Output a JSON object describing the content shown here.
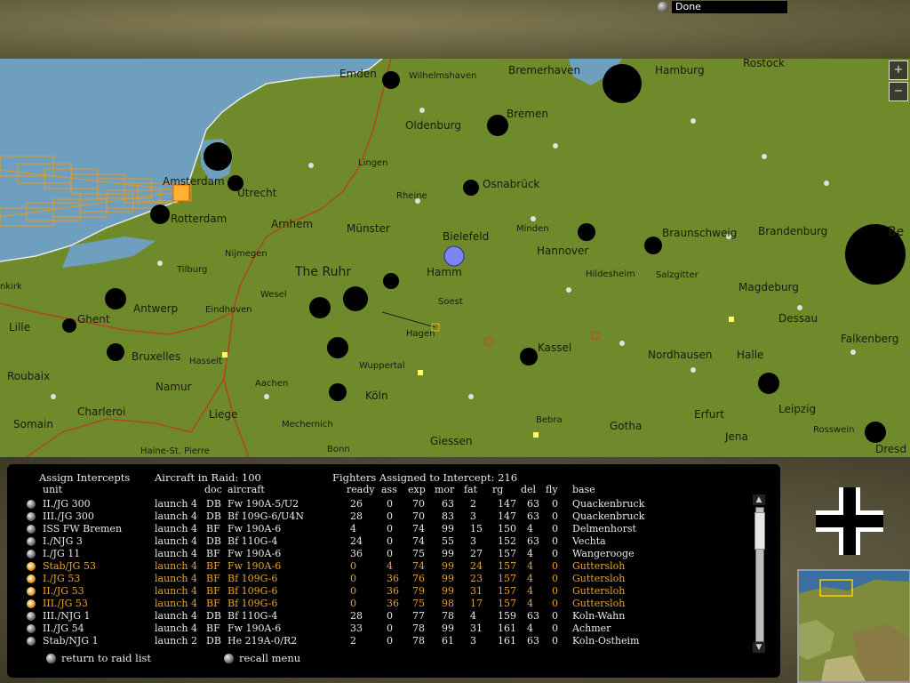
{
  "top": {
    "done_label": "Done"
  },
  "map": {
    "zoom_in": "+",
    "zoom_out": "−",
    "cities": [
      {
        "name": "Emden"
      },
      {
        "name": "Wilhelmshaven"
      },
      {
        "name": "Bremerhaven"
      },
      {
        "name": "Hamburg"
      },
      {
        "name": "Rostock"
      },
      {
        "name": "Bremen"
      },
      {
        "name": "Oldenburg"
      },
      {
        "name": "Lingen"
      },
      {
        "name": "Amsterdam"
      },
      {
        "name": "Utrecht"
      },
      {
        "name": "Osnabrück"
      },
      {
        "name": "Rheine"
      },
      {
        "name": "Rotterdam"
      },
      {
        "name": "Arnhem"
      },
      {
        "name": "Münster"
      },
      {
        "name": "Bielefeld"
      },
      {
        "name": "Minden"
      },
      {
        "name": "Braunschweig"
      },
      {
        "name": "Brandenburg"
      },
      {
        "name": "Be"
      },
      {
        "name": "Nijmegen"
      },
      {
        "name": "Tilburg"
      },
      {
        "name": "The Ruhr"
      },
      {
        "name": "Hamm"
      },
      {
        "name": "Hannover"
      },
      {
        "name": "Hildesheim"
      },
      {
        "name": "Salzgitter"
      },
      {
        "name": "Magdeburg"
      },
      {
        "name": "Wesel"
      },
      {
        "name": "Soest"
      },
      {
        "name": "Antwerp"
      },
      {
        "name": "Eindhoven"
      },
      {
        "name": "Ghent"
      },
      {
        "name": "Dessau"
      },
      {
        "name": "Hagen"
      },
      {
        "name": "Lille"
      },
      {
        "name": "Falkenberg"
      },
      {
        "name": "Kassel"
      },
      {
        "name": "Bruxelles"
      },
      {
        "name": "Wuppertal"
      },
      {
        "name": "Nordhausen"
      },
      {
        "name": "Halle"
      },
      {
        "name": "Roubaix"
      },
      {
        "name": "Hasselt"
      },
      {
        "name": "Aachen"
      },
      {
        "name": "Namur"
      },
      {
        "name": "Köln"
      },
      {
        "name": "Leipzig"
      },
      {
        "name": "Charleroi"
      },
      {
        "name": "Liege"
      },
      {
        "name": "Erfurt"
      },
      {
        "name": "Somain"
      },
      {
        "name": "Mechernich"
      },
      {
        "name": "Bebra"
      },
      {
        "name": "Gotha"
      },
      {
        "name": "Rosswein"
      },
      {
        "name": "Jena"
      },
      {
        "name": "Giessen"
      },
      {
        "name": "Haine-St. Pierre"
      },
      {
        "name": "Bonn"
      },
      {
        "name": "Dresd"
      },
      {
        "name": "nkirk"
      }
    ]
  },
  "panel": {
    "title": "Assign Intercepts",
    "aircraft_in_raid": "Aircraft in Raid: 100",
    "fighters_assigned": "Fighters Assigned to Intercept: 216",
    "columns": [
      "unit",
      "doc",
      "aircraft",
      "ready",
      "ass",
      "exp",
      "mor",
      "fat",
      "rg",
      "del",
      "fly",
      "base"
    ],
    "rows": [
      {
        "unit": "II./JG 300",
        "doc": "launch 4",
        "type": "DB",
        "aircraft": "Fw 190A-5/U2",
        "ready": "26",
        "ass": "0",
        "exp": "70",
        "mor": "63",
        "fat": "2",
        "rg": "147",
        "del": "63",
        "fly": "0",
        "base": "Quackenbruck",
        "selected": false
      },
      {
        "unit": "III./JG 300",
        "doc": "launch 4",
        "type": "DB",
        "aircraft": "Bf 109G-6/U4N",
        "ready": "28",
        "ass": "0",
        "exp": "70",
        "mor": "83",
        "fat": "3",
        "rg": "147",
        "del": "63",
        "fly": "0",
        "base": "Quackenbruck",
        "selected": false
      },
      {
        "unit": "ISS FW Bremen",
        "doc": "launch 4",
        "type": "BF",
        "aircraft": "Fw 190A-6",
        "ready": "4",
        "ass": "0",
        "exp": "74",
        "mor": "99",
        "fat": "15",
        "rg": "150",
        "del": "4",
        "fly": "0",
        "base": "Delmenhorst",
        "selected": false
      },
      {
        "unit": "I./NJG 3",
        "doc": "launch 4",
        "type": "DB",
        "aircraft": "Bf 110G-4",
        "ready": "24",
        "ass": "0",
        "exp": "74",
        "mor": "55",
        "fat": "3",
        "rg": "152",
        "del": "63",
        "fly": "0",
        "base": "Vechta",
        "selected": false
      },
      {
        "unit": "I./JG 11",
        "doc": "launch 4",
        "type": "BF",
        "aircraft": "Fw 190A-6",
        "ready": "36",
        "ass": "0",
        "exp": "75",
        "mor": "99",
        "fat": "27",
        "rg": "157",
        "del": "4",
        "fly": "0",
        "base": "Wangerooge",
        "selected": false
      },
      {
        "unit": "Stab/JG 53",
        "doc": "launch 4",
        "type": "BF",
        "aircraft": "Fw 190A-6",
        "ready": "0",
        "ass": "4",
        "exp": "74",
        "mor": "99",
        "fat": "24",
        "rg": "157",
        "del": "4",
        "fly": "0",
        "base": "Guttersloh",
        "selected": true
      },
      {
        "unit": "I./JG 53",
        "doc": "launch 4",
        "type": "BF",
        "aircraft": "Bf 109G-6",
        "ready": "0",
        "ass": "36",
        "exp": "76",
        "mor": "99",
        "fat": "23",
        "rg": "157",
        "del": "4",
        "fly": "0",
        "base": "Guttersloh",
        "selected": true
      },
      {
        "unit": "II./JG 53",
        "doc": "launch 4",
        "type": "BF",
        "aircraft": "Bf 109G-6",
        "ready": "0",
        "ass": "36",
        "exp": "79",
        "mor": "99",
        "fat": "31",
        "rg": "157",
        "del": "4",
        "fly": "0",
        "base": "Guttersloh",
        "selected": true
      },
      {
        "unit": "III./JG 53",
        "doc": "launch 4",
        "type": "BF",
        "aircraft": "Bf 109G-6",
        "ready": "0",
        "ass": "36",
        "exp": "75",
        "mor": "98",
        "fat": "17",
        "rg": "157",
        "del": "4",
        "fly": "0",
        "base": "Guttersloh",
        "selected": true
      },
      {
        "unit": "III./NJG 1",
        "doc": "launch 4",
        "type": "DB",
        "aircraft": "Bf 110G-4",
        "ready": "28",
        "ass": "0",
        "exp": "77",
        "mor": "78",
        "fat": "4",
        "rg": "159",
        "del": "63",
        "fly": "0",
        "base": "Koln-Wahn",
        "selected": false
      },
      {
        "unit": "II./JG 54",
        "doc": "launch 4",
        "type": "BF",
        "aircraft": "Fw 190A-6",
        "ready": "33",
        "ass": "0",
        "exp": "78",
        "mor": "99",
        "fat": "31",
        "rg": "161",
        "del": "4",
        "fly": "0",
        "base": "Achmer",
        "selected": false
      },
      {
        "unit": "Stab/NJG 1",
        "doc": "launch 2",
        "type": "DB",
        "aircraft": "He 219A-0/R2",
        "ready": "2",
        "ass": "0",
        "exp": "78",
        "mor": "61",
        "fat": "3",
        "rg": "161",
        "del": "63",
        "fly": "0",
        "base": "Koln-Ostheim",
        "selected": false
      }
    ],
    "return_label": "return to raid list",
    "recall_label": "recall menu"
  },
  "colors": {
    "map_land": "#6f8a2b",
    "sea": "#6f9fbf",
    "selected_text": "#e6a42a",
    "border_red": "#b4461f"
  }
}
